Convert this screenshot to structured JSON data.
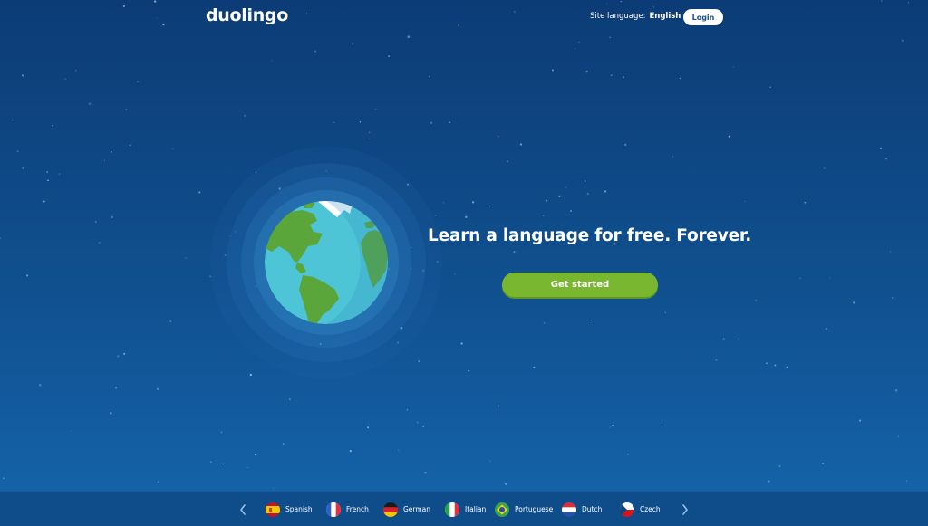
{
  "header": {
    "logo_text": "duolingo",
    "site_language_label": "Site language:",
    "site_language_value": "English",
    "login_label": "Login"
  },
  "hero": {
    "tagline": "Learn a language for free. Forever.",
    "cta_label": "Get started"
  },
  "languages": [
    {
      "label": "Spanish",
      "flag": "spain-flag-icon"
    },
    {
      "label": "French",
      "flag": "france-flag-icon"
    },
    {
      "label": "German",
      "flag": "germany-flag-icon"
    },
    {
      "label": "Italian",
      "flag": "italy-flag-icon"
    },
    {
      "label": "Portuguese",
      "flag": "brazil-flag-icon"
    },
    {
      "label": "Dutch",
      "flag": "netherlands-flag-icon"
    },
    {
      "label": "Czech",
      "flag": "czech-flag-icon"
    }
  ],
  "colors": {
    "background": "#10508f",
    "cta": "#7ab731",
    "language_bar": "#0f4c8a",
    "ocean": "#4ec5d6",
    "land": "#5aa63a"
  }
}
